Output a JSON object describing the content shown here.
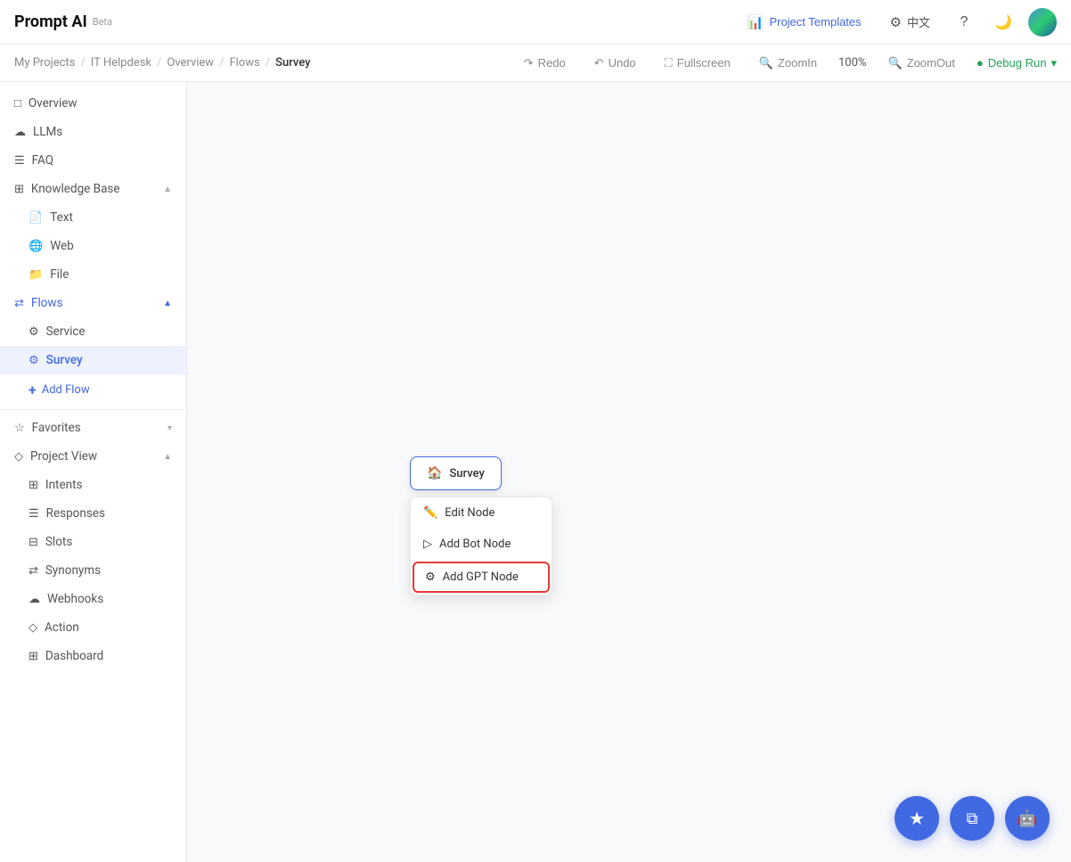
{
  "app": {
    "name": "Prompt AI",
    "beta_label": "Beta"
  },
  "topbar": {
    "project_templates_label": "Project Templates",
    "language_label": "中文",
    "help_icon": "?",
    "theme_icon": "🌙"
  },
  "breadcrumb": {
    "items": [
      "My Projects",
      "IT Helpdesk",
      "Overview",
      "Flows",
      "Survey"
    ],
    "redo_label": "Redo",
    "undo_label": "Undo",
    "fullscreen_label": "Fullscreen",
    "zoomin_label": "ZoomIn",
    "zoom_pct": "100%",
    "zoomout_label": "ZoomOut",
    "debug_run_label": "Debug Run"
  },
  "sidebar": {
    "items": [
      {
        "id": "overview",
        "label": "Overview",
        "icon": "□",
        "level": 0
      },
      {
        "id": "llms",
        "label": "LLMs",
        "icon": "☁",
        "level": 0
      },
      {
        "id": "faq",
        "label": "FAQ",
        "icon": "☰",
        "level": 0
      },
      {
        "id": "knowledge-base",
        "label": "Knowledge Base",
        "icon": "⊞",
        "level": 0,
        "expandable": true,
        "expanded": true
      },
      {
        "id": "text",
        "label": "Text",
        "icon": "📄",
        "level": 1
      },
      {
        "id": "web",
        "label": "Web",
        "icon": "🌐",
        "level": 1
      },
      {
        "id": "file",
        "label": "File",
        "icon": "📁",
        "level": 1
      },
      {
        "id": "flows",
        "label": "Flows",
        "icon": "⇄",
        "level": 0,
        "expandable": true,
        "expanded": true,
        "active_color": true
      },
      {
        "id": "service",
        "label": "Service",
        "icon": "⚙",
        "level": 1
      },
      {
        "id": "survey",
        "label": "Survey",
        "icon": "⚙",
        "level": 1,
        "active": true
      },
      {
        "id": "add-flow",
        "label": "Add Flow",
        "level": 1,
        "is_add": true
      },
      {
        "id": "favorites",
        "label": "Favorites",
        "icon": "☆",
        "level": 0,
        "expandable": true,
        "expanded": false
      },
      {
        "id": "project-view",
        "label": "Project View",
        "icon": "◇",
        "level": 0,
        "expandable": true,
        "expanded": true
      },
      {
        "id": "intents",
        "label": "Intents",
        "icon": "⊞",
        "level": 1
      },
      {
        "id": "responses",
        "label": "Responses",
        "icon": "☰",
        "level": 1
      },
      {
        "id": "slots",
        "label": "Slots",
        "icon": "⊟",
        "level": 1
      },
      {
        "id": "synonyms",
        "label": "Synonyms",
        "icon": "⇄",
        "level": 1
      },
      {
        "id": "webhooks",
        "label": "Webhooks",
        "icon": "☁",
        "level": 1
      },
      {
        "id": "action",
        "label": "Action",
        "icon": "◇",
        "level": 1
      },
      {
        "id": "dashboard",
        "label": "Dashboard",
        "icon": "⊞",
        "level": 1
      }
    ]
  },
  "canvas": {
    "survey_node_label": "Survey",
    "context_menu": {
      "edit_node_label": "Edit Node",
      "add_bot_node_label": "Add Bot Node",
      "add_gpt_node_label": "Add GPT Node"
    }
  },
  "fab_buttons": [
    {
      "id": "star",
      "icon": "★"
    },
    {
      "id": "copy",
      "icon": "📋"
    },
    {
      "id": "bot",
      "icon": "🤖"
    }
  ],
  "colors": {
    "accent": "#4169e1",
    "active_bg": "#eef2ff",
    "highlight_red": "#e53935",
    "green": "#22a355"
  }
}
